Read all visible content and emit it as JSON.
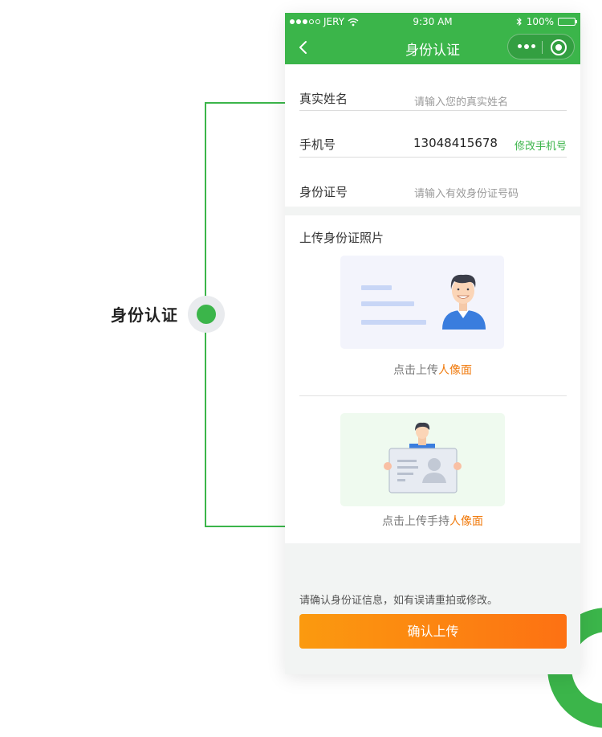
{
  "annotation": {
    "label": "身份认证"
  },
  "status_bar": {
    "carrier": "JERY",
    "time": "9:30 AM",
    "battery": "100%"
  },
  "navbar": {
    "title": "身份认证"
  },
  "form": {
    "name": {
      "label": "真实姓名",
      "placeholder": "请输入您的真实姓名"
    },
    "phone": {
      "label": "手机号",
      "value": "13048415678",
      "action": "修改手机号"
    },
    "id_number": {
      "label": "身份证号",
      "placeholder": "请输入有效身份证号码"
    }
  },
  "upload": {
    "title": "上传身份证照片",
    "front": {
      "caption_prefix": "点击上传",
      "caption_highlight": "人像面"
    },
    "handheld": {
      "caption_prefix": "点击上传手持",
      "caption_highlight": "人像面"
    }
  },
  "footer": {
    "note": "请确认身份证信息，如有误请重拍或修改。",
    "submit_label": "确认上传"
  },
  "colors": {
    "brand_green": "#3bb54a",
    "highlight_orange": "#f07a0c",
    "button_start": "#fb9a0f",
    "button_end": "#fd7113"
  }
}
